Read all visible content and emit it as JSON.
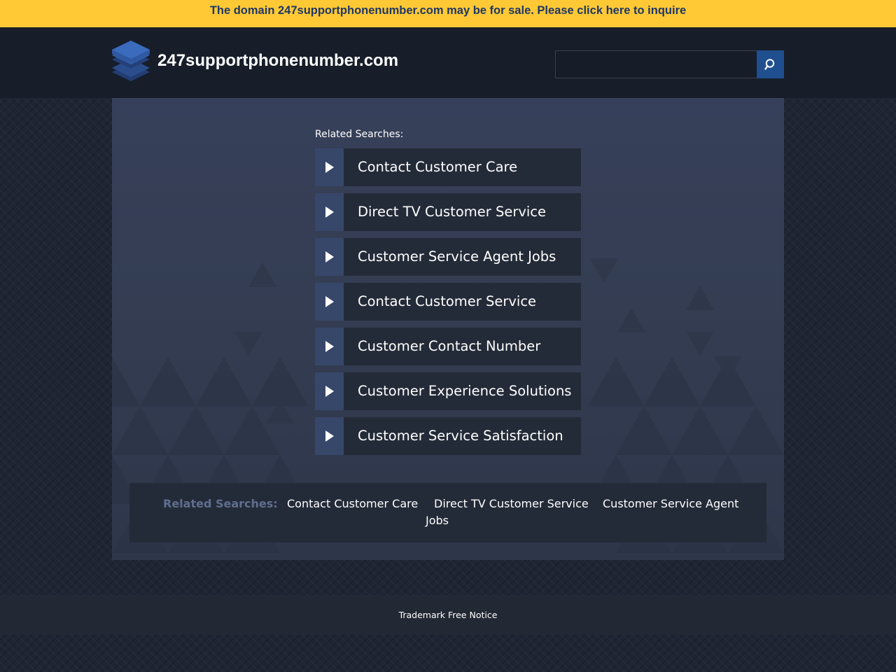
{
  "banner": {
    "text": "The domain 247supportphonenumber.com may be for sale. Please click here to inquire",
    "background": "#ffc935",
    "color": "#1f3764"
  },
  "header": {
    "title": "247supportphonenumber.com",
    "logo_icon": "stacked-layers-icon",
    "search": {
      "placeholder": "",
      "value": "",
      "button_icon": "search-icon",
      "button_color": "#1f4f8f"
    }
  },
  "main": {
    "related_heading": "Related Searches:",
    "links": [
      {
        "label": "Contact Customer Care"
      },
      {
        "label": "Direct TV Customer Service"
      },
      {
        "label": "Customer Service Agent Jobs"
      },
      {
        "label": "Contact Customer Service"
      },
      {
        "label": "Customer Contact Number"
      },
      {
        "label": "Customer Experience Solutions"
      },
      {
        "label": "Customer Service Satisfaction"
      }
    ],
    "arrow_icon": "play-arrow-icon"
  },
  "footer_related": {
    "heading": "Related Searches:",
    "links": [
      {
        "label": "Contact Customer Care"
      },
      {
        "label": "Direct TV Customer Service"
      },
      {
        "label": "Customer Service Agent"
      },
      {
        "label": "Jobs"
      }
    ]
  },
  "footer": {
    "trademark": "Trademark Free Notice"
  },
  "colors": {
    "page_background": "#1f2532",
    "header_background": "#171e2a",
    "link_background": "#242b38",
    "arrow_background": "#37476a"
  }
}
